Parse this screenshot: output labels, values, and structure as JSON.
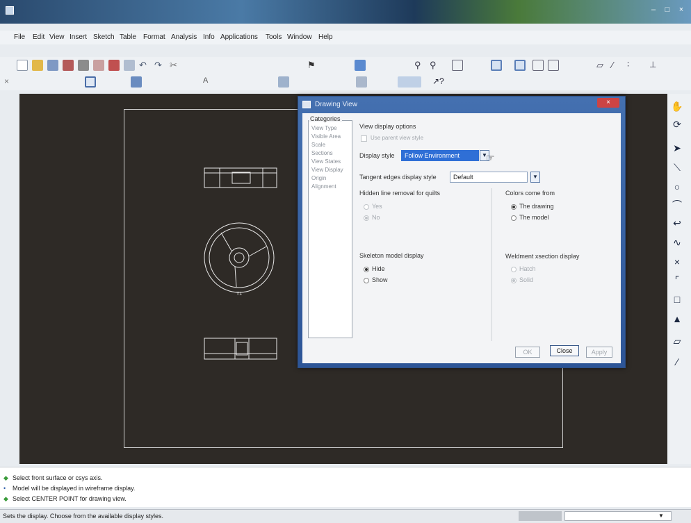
{
  "window": {
    "title": ""
  },
  "menu": [
    "File",
    "Edit",
    "View",
    "Insert",
    "Sketch",
    "Table",
    "Format",
    "Analysis",
    "Info",
    "Applications",
    "Tools",
    "Window",
    "Help"
  ],
  "dialog": {
    "title": "Drawing View",
    "categories_header": "Categories",
    "categories": [
      "View Type",
      "Visible Area",
      "Scale",
      "Sections",
      "View States",
      "View Display",
      "Origin",
      "Alignment"
    ],
    "section_title": "View display options",
    "use_parent_label": "Use parent view style",
    "display_style_label": "Display style",
    "display_style_value": "Follow Environment",
    "tangent_label": "Tangent edges display style",
    "tangent_value": "Default",
    "hidden_line_label": "Hidden line removal for quilts",
    "hidden_yes": "Yes",
    "hidden_no": "No",
    "colors_label": "Colors come from",
    "colors_drawing": "The drawing",
    "colors_model": "The model",
    "skeleton_label": "Skeleton model display",
    "skeleton_hide": "Hide",
    "skeleton_show": "Show",
    "weldment_label": "Weldment xsection display",
    "weldment_hatch": "Hatch",
    "weldment_solid": "Solid",
    "ok": "OK",
    "close": "Close",
    "apply": "Apply"
  },
  "messages": [
    {
      "icon": "check-icon",
      "text": "Select front surface or csys axis."
    },
    {
      "icon": "bullet-icon",
      "text": "Model will be displayed in wireframe display."
    },
    {
      "icon": "check-icon",
      "text": "Select CENTER POINT for drawing view."
    }
  ],
  "status": {
    "text": "Sets the display.  Choose from the available display styles."
  },
  "colors": {
    "canvas": "#2e2a26",
    "dialog_title": "#3a64a6",
    "selection": "#2f6fd6"
  }
}
